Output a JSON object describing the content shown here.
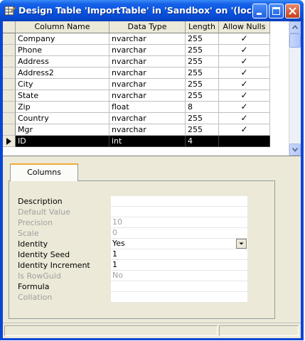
{
  "window": {
    "title": "Design Table 'ImportTable' in 'Sandbox' on '(local)'",
    "icon": "table-design-icon"
  },
  "grid": {
    "columns": [
      "Column Name",
      "Data Type",
      "Length",
      "Allow Nulls"
    ],
    "rows": [
      {
        "name": "Company",
        "type": "nvarchar",
        "length": "255",
        "nulls": "✓"
      },
      {
        "name": "Phone",
        "type": "nvarchar",
        "length": "255",
        "nulls": "✓"
      },
      {
        "name": "Address",
        "type": "nvarchar",
        "length": "255",
        "nulls": "✓"
      },
      {
        "name": "Address2",
        "type": "nvarchar",
        "length": "255",
        "nulls": "✓"
      },
      {
        "name": "City",
        "type": "nvarchar",
        "length": "255",
        "nulls": "✓"
      },
      {
        "name": "State",
        "type": "nvarchar",
        "length": "255",
        "nulls": "✓"
      },
      {
        "name": "Zip",
        "type": "float",
        "length": "8",
        "nulls": "✓"
      },
      {
        "name": "Country",
        "type": "nvarchar",
        "length": "255",
        "nulls": "✓"
      },
      {
        "name": "Mgr",
        "type": "nvarchar",
        "length": "255",
        "nulls": "✓"
      },
      {
        "name": "ID",
        "type": "int",
        "length": "4",
        "nulls": ""
      }
    ],
    "selected_row": 9
  },
  "tabs": [
    "Columns"
  ],
  "properties": [
    {
      "label": "Description",
      "value": "",
      "disabled": false
    },
    {
      "label": "Default Value",
      "value": "",
      "disabled": true
    },
    {
      "label": "Precision",
      "value": "10",
      "disabled": true
    },
    {
      "label": "Scale",
      "value": "0",
      "disabled": true
    },
    {
      "label": "Identity",
      "value": "Yes",
      "disabled": false,
      "dropdown": true
    },
    {
      "label": "Identity Seed",
      "value": "1",
      "disabled": false
    },
    {
      "label": "Identity Increment",
      "value": "1",
      "disabled": false
    },
    {
      "label": "Is RowGuid",
      "value": "No",
      "disabled": true
    },
    {
      "label": "Formula",
      "value": "",
      "disabled": false
    },
    {
      "label": "Collation",
      "value": "",
      "disabled": true
    }
  ],
  "colors": {
    "titlebar": "#0a54de",
    "selection": "#000000",
    "tab_highlight": "#f0a93a"
  }
}
